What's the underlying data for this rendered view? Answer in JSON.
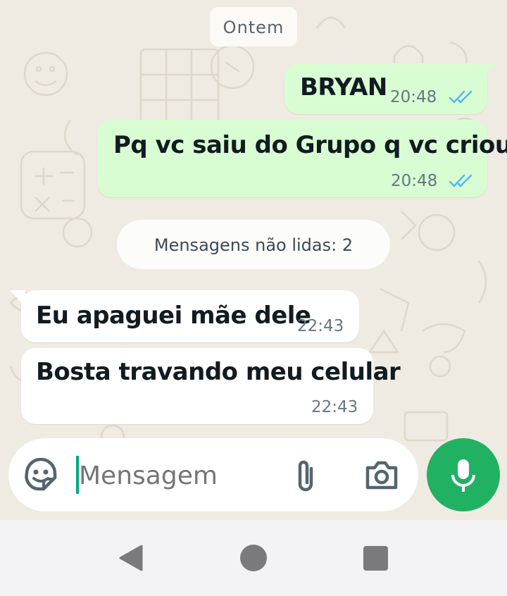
{
  "date_separator": "Ontem",
  "unread_label": "Mensagens não lidas: 2",
  "messages": [
    {
      "direction": "out",
      "text": "BRYAN",
      "time": "20:48",
      "status": "read"
    },
    {
      "direction": "out",
      "text": "Pq vc saiu do Grupo q vc criou?",
      "time": "20:48",
      "status": "read"
    },
    {
      "direction": "in",
      "text": "Eu apaguei mãe dele",
      "time": "22:43"
    },
    {
      "direction": "in",
      "text": "Bosta travando meu celular",
      "time": "22:43"
    }
  ],
  "composer": {
    "placeholder": "Mensagem",
    "icons": [
      "sticker-icon",
      "attach-icon",
      "camera-icon",
      "mic-icon"
    ]
  },
  "navbar": {
    "icons": [
      "back-icon",
      "home-icon",
      "recents-icon"
    ]
  },
  "colors": {
    "chat_bg": "#efeae2",
    "outgoing_bubble": "#d9fdd3",
    "incoming_bubble": "#ffffff",
    "read_ticks": "#53bdeb",
    "mic_button": "#21b163",
    "cursor": "#00a884",
    "navbar": "#f3f3f5"
  }
}
